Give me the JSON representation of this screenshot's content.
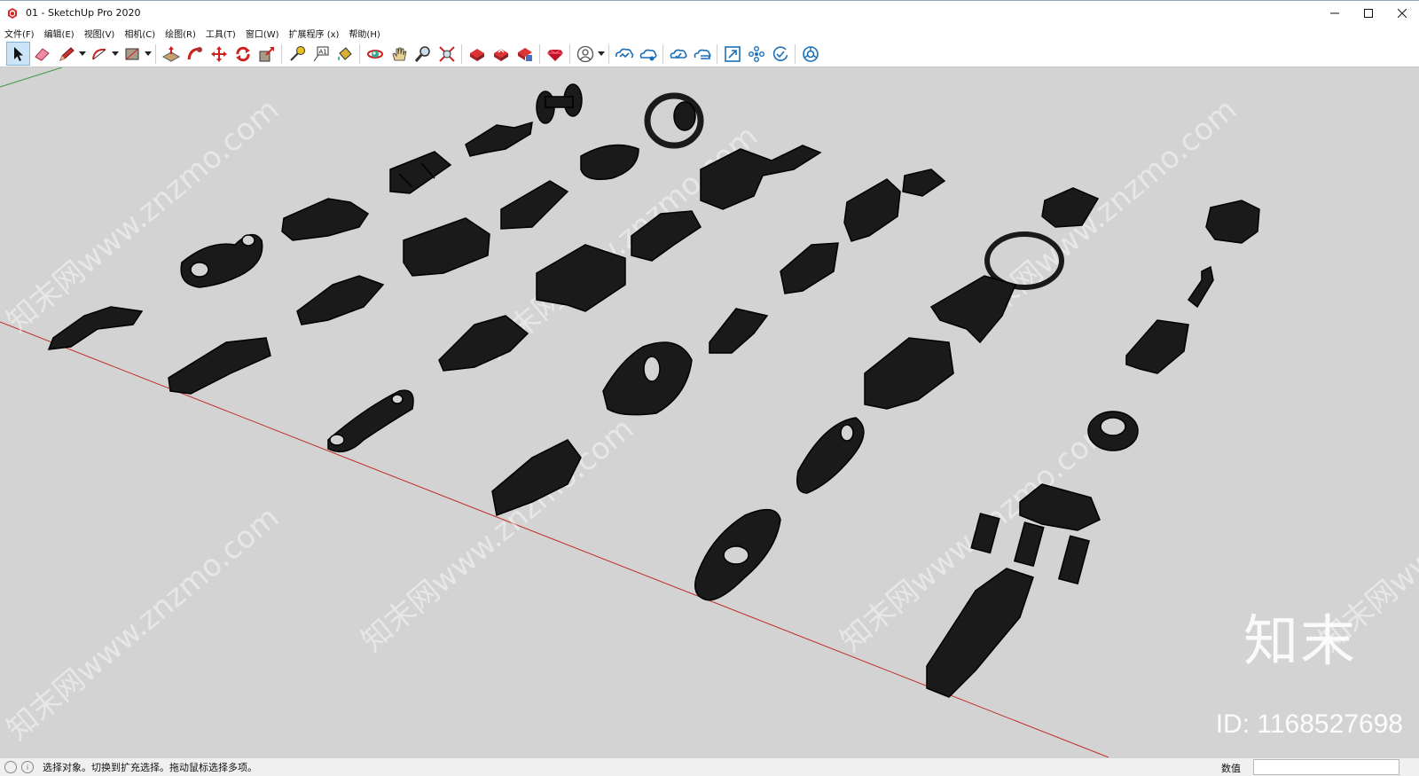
{
  "window": {
    "title": "01 - SketchUp Pro 2020",
    "minimize_glyph": "—",
    "maximize_glyph": "☐",
    "close_glyph": "✕"
  },
  "menu": [
    {
      "label": "文件(F)"
    },
    {
      "label": "编辑(E)"
    },
    {
      "label": "视图(V)"
    },
    {
      "label": "相机(C)"
    },
    {
      "label": "绘图(R)"
    },
    {
      "label": "工具(T)"
    },
    {
      "label": "窗口(W)"
    },
    {
      "label": "扩展程序 (x)"
    },
    {
      "label": "帮助(H)"
    }
  ],
  "toolbar": {
    "icons": [
      "select-icon",
      "eraser-icon",
      "pencil-icon",
      "arc-icon",
      "rectangle-icon",
      "push-pull-icon",
      "follow-me-icon",
      "move-icon",
      "rotate-icon",
      "scale-icon",
      "tape-measure-icon",
      "text-label-icon",
      "paint-bucket-icon",
      "orbit-icon",
      "pan-icon",
      "zoom-icon",
      "zoom-extents-icon",
      "warehouse-icon",
      "share-model-icon",
      "extension-warehouse-icon",
      "ruby-icon",
      "account-icon",
      "trimble-connect-icon",
      "cloud-share-icon",
      "cloud-sync-icon",
      "cloud-list-icon",
      "layout-icon",
      "styles-icon",
      "check-icon",
      "web-icon"
    ],
    "text_tool_glyph": "A1"
  },
  "viewport": {
    "background": "#d3d3d3",
    "part_color": "#1a1a1a",
    "watermark_text": "知末网www.znzmo.com",
    "brand": "知末",
    "image_id": "ID: 1168527698"
  },
  "status": {
    "info_glyph": "i",
    "text": "选择对象。切换到扩充选择。拖动鼠标选择多项。",
    "measurement_label": "数值",
    "measurement_value": ""
  }
}
